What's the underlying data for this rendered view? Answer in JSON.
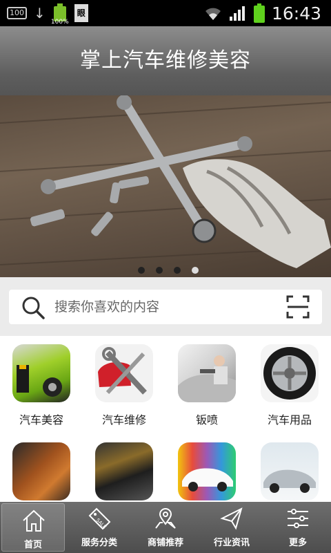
{
  "status_bar": {
    "left_badge": "100",
    "battery_small_pct": "100%",
    "doc_label": "眼",
    "time": "16:43",
    "battery_color": "#5fd11d"
  },
  "header": {
    "title": "掌上汽车维修美容"
  },
  "banner": {
    "slide_count": 4,
    "active_slide": 4
  },
  "search": {
    "placeholder": "搜索你喜欢的内容"
  },
  "categories": [
    {
      "label": "汽车美容",
      "icon": "car-beauty-photo"
    },
    {
      "label": "汽车维修",
      "icon": "car-repair-photo"
    },
    {
      "label": "钣喷",
      "icon": "spray-paint-photo"
    },
    {
      "label": "汽车用品",
      "icon": "wheel-photo"
    },
    {
      "label": "",
      "icon": "car-interior-photo"
    },
    {
      "label": "",
      "icon": "engine-repair-photo"
    },
    {
      "label": "",
      "icon": "sports-car-photo"
    },
    {
      "label": "",
      "icon": "car-wash-photo"
    }
  ],
  "nav": [
    {
      "label": "首页",
      "icon": "home-icon",
      "active": true
    },
    {
      "label": "服务分类",
      "icon": "sale-tag-icon",
      "active": false
    },
    {
      "label": "商铺推荐",
      "icon": "map-pin-icon",
      "active": false
    },
    {
      "label": "行业资讯",
      "icon": "send-icon",
      "active": false
    },
    {
      "label": "更多",
      "icon": "sliders-icon",
      "active": false
    }
  ],
  "colors": {
    "header": "#6e6e6e",
    "nav": "#5a5a5a",
    "accent_green": "#5fd11d"
  }
}
